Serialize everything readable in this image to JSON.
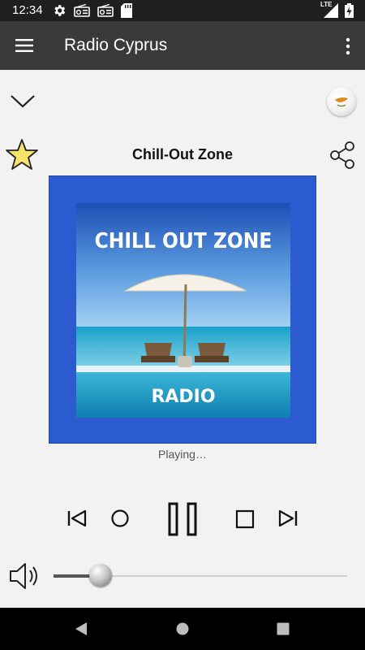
{
  "status_bar": {
    "time": "12:34",
    "icons": [
      "gear-icon",
      "radio-icon",
      "radio-icon",
      "sd-card-icon"
    ],
    "network": "LTE",
    "battery": "charging"
  },
  "app_bar": {
    "title": "Radio Cyprus",
    "menu_icon": "hamburger-icon",
    "overflow_icon": "more-vert-icon"
  },
  "player": {
    "station_name": "Chill-Out Zone",
    "favorite_icon": "star-icon",
    "share_icon": "share-icon",
    "collapse_icon": "chevron-down-icon",
    "flag_icon": "cyprus-flag-icon",
    "artwork": {
      "headline": "CHILL OUT ZONE",
      "footer": "RADIO",
      "border_color": "#2b5bcf"
    },
    "status": "Playing…"
  },
  "controls": {
    "previous": "skip-previous-icon",
    "record": "record-icon",
    "play_pause": "pause-icon",
    "stop": "stop-icon",
    "next": "skip-next-icon"
  },
  "volume": {
    "icon": "speaker-icon",
    "level": 0.16
  },
  "nav_bar": {
    "back": "back-icon",
    "home": "home-icon",
    "recents": "recents-icon"
  }
}
